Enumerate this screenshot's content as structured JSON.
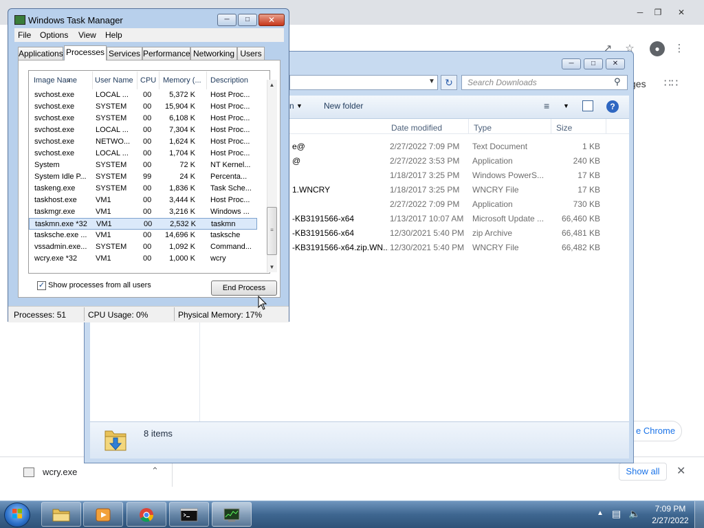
{
  "chrome": {
    "frag_ges": "ges",
    "frag_chrome": "e Chrome",
    "download": {
      "filename": "wcry.exe",
      "show_all": "Show all"
    }
  },
  "explorer": {
    "search_placeholder": "Search Downloads",
    "new_folder": "New folder",
    "organize_frag": "n",
    "columns": {
      "date": "Date modified",
      "type": "Type",
      "size": "Size"
    },
    "files": [
      {
        "name": "e@",
        "date": "2/27/2022 7:09 PM",
        "type": "Text Document",
        "size": "1 KB"
      },
      {
        "name": "@",
        "date": "2/27/2022 3:53 PM",
        "type": "Application",
        "size": "240 KB"
      },
      {
        "name": "",
        "date": "1/18/2017 3:25 PM",
        "type": "Windows PowerS...",
        "size": "17 KB"
      },
      {
        "name": "1.WNCRY",
        "date": "1/18/2017 3:25 PM",
        "type": "WNCRY File",
        "size": "17 KB"
      },
      {
        "name": "",
        "date": "2/27/2022 7:09 PM",
        "type": "Application",
        "size": "730 KB"
      },
      {
        "name": "-KB3191566-x64",
        "date": "1/13/2017 10:07 AM",
        "type": "Microsoft Update ...",
        "size": "66,460 KB"
      },
      {
        "name": "-KB3191566-x64",
        "date": "12/30/2021 5:40 PM",
        "type": "zip Archive",
        "size": "66,481 KB"
      },
      {
        "name": "-KB3191566-x64.zip.WN...",
        "date": "12/30/2021 5:40 PM",
        "type": "WNCRY File",
        "size": "66,482 KB"
      }
    ],
    "status_items": "8 items"
  },
  "taskmgr": {
    "title": "Windows Task Manager",
    "menu": [
      "File",
      "Options",
      "View",
      "Help"
    ],
    "tabs": [
      "Applications",
      "Processes",
      "Services",
      "Performance",
      "Networking",
      "Users"
    ],
    "active_tab": "Processes",
    "columns": [
      "Image Name",
      "User Name",
      "CPU",
      "Memory (...",
      "Description"
    ],
    "processes": [
      {
        "image": "svchost.exe",
        "user": "LOCAL ...",
        "cpu": "00",
        "mem": "5,372 K",
        "desc": "Host Proc..."
      },
      {
        "image": "svchost.exe",
        "user": "SYSTEM",
        "cpu": "00",
        "mem": "15,904 K",
        "desc": "Host Proc..."
      },
      {
        "image": "svchost.exe",
        "user": "SYSTEM",
        "cpu": "00",
        "mem": "6,108 K",
        "desc": "Host Proc..."
      },
      {
        "image": "svchost.exe",
        "user": "LOCAL ...",
        "cpu": "00",
        "mem": "7,304 K",
        "desc": "Host Proc..."
      },
      {
        "image": "svchost.exe",
        "user": "NETWO...",
        "cpu": "00",
        "mem": "1,624 K",
        "desc": "Host Proc..."
      },
      {
        "image": "svchost.exe",
        "user": "LOCAL ...",
        "cpu": "00",
        "mem": "1,704 K",
        "desc": "Host Proc..."
      },
      {
        "image": "System",
        "user": "SYSTEM",
        "cpu": "00",
        "mem": "72 K",
        "desc": "NT Kernel..."
      },
      {
        "image": "System Idle P...",
        "user": "SYSTEM",
        "cpu": "99",
        "mem": "24 K",
        "desc": "Percenta..."
      },
      {
        "image": "taskeng.exe",
        "user": "SYSTEM",
        "cpu": "00",
        "mem": "1,836 K",
        "desc": "Task Sche..."
      },
      {
        "image": "taskhost.exe",
        "user": "VM1",
        "cpu": "00",
        "mem": "3,444 K",
        "desc": "Host Proc..."
      },
      {
        "image": "taskmgr.exe",
        "user": "VM1",
        "cpu": "00",
        "mem": "3,216 K",
        "desc": "Windows ..."
      },
      {
        "image": "taskmn.exe *32",
        "user": "VM1",
        "cpu": "00",
        "mem": "2,532 K",
        "desc": "taskmn"
      },
      {
        "image": "tasksche.exe ...",
        "user": "VM1",
        "cpu": "00",
        "mem": "14,696 K",
        "desc": "tasksche"
      },
      {
        "image": "vssadmin.exe...",
        "user": "SYSTEM",
        "cpu": "00",
        "mem": "1,092 K",
        "desc": "Command..."
      },
      {
        "image": "wcry.exe *32",
        "user": "VM1",
        "cpu": "00",
        "mem": "1,000 K",
        "desc": "wcry"
      }
    ],
    "selected_process": "taskmn.exe *32",
    "show_all_users": "Show processes from all users",
    "end_process": "End Process",
    "status": {
      "processes": "Processes: 51",
      "cpu": "CPU Usage: 0%",
      "memory": "Physical Memory: 17%"
    }
  },
  "taskbar": {
    "time": "7:09 PM",
    "date": "2/27/2022"
  }
}
